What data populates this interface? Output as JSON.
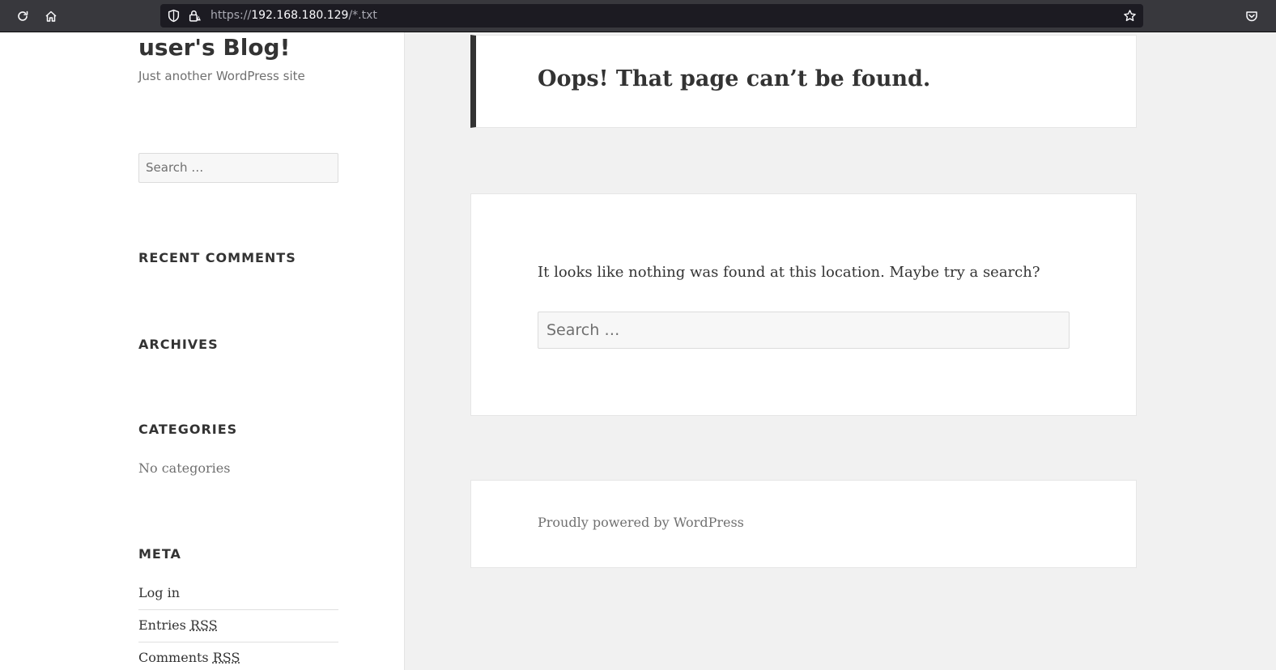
{
  "browser": {
    "url_prefix": "https://",
    "url_host": "192.168.180.129",
    "url_path": "/*.txt",
    "icons": [
      "reload-icon",
      "home-icon",
      "shield-icon",
      "insecure-lock-icon",
      "bookmark-star-icon",
      "pocket-icon"
    ]
  },
  "sidebar": {
    "site_title": "user's Blog!",
    "site_description": "Just another WordPress site",
    "search_placeholder": "Search …",
    "recent_comments_title": "Recent Comments",
    "archives_title": "Archives",
    "categories_title": "Categories",
    "categories_empty": "No categories",
    "meta_title": "Meta",
    "meta_links": [
      {
        "label": "Log in"
      },
      {
        "label": "Entries ",
        "abbr": "RSS"
      },
      {
        "label": "Comments ",
        "abbr": "RSS"
      }
    ]
  },
  "main": {
    "page_title": "Oops! That page can’t be found.",
    "message": "It looks like nothing was found at this location. Maybe try a search?",
    "search_placeholder": "Search …",
    "footer": "Proudly powered by WordPress"
  },
  "colors": {
    "toolbar_bg": "#38383d",
    "urlbar_bg": "#1c1b22",
    "page_bg": "#f1f1f1",
    "text_dark": "#333333",
    "text_muted": "#707070"
  }
}
